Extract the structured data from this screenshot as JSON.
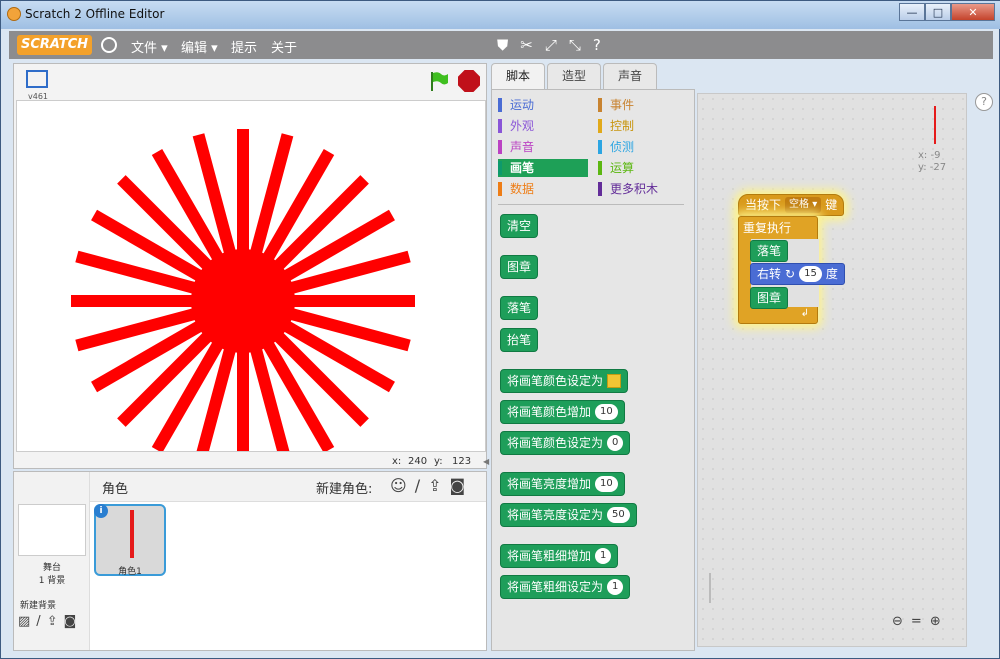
{
  "window": {
    "title": "Scratch 2 Offline Editor",
    "minimize": "—",
    "maximize": "□",
    "close": "✕"
  },
  "menubar": {
    "logo": "SCRATCH",
    "file": "文件 ▾",
    "edit": "编辑 ▾",
    "tips": "提示",
    "about": "关于"
  },
  "stage": {
    "version": "v461",
    "mouse_x_label": "x:",
    "mouse_x": "240",
    "mouse_y_label": "y:",
    "mouse_y": "123",
    "drawing": {
      "lines": 24,
      "color": "#ff0000"
    }
  },
  "sprites": {
    "header": "角色",
    "new_sprite_label": "新建角色:",
    "stage_label": "舞台",
    "stage_backdrops": "1 背景",
    "new_backdrop": "新建背景",
    "sprite1_name": "角色1"
  },
  "tabs": [
    "脚本",
    "造型",
    "声音"
  ],
  "categories": [
    {
      "label": "运动",
      "color": "#4a6cd4"
    },
    {
      "label": "事件",
      "color": "#c88330"
    },
    {
      "label": "外观",
      "color": "#8a55d7"
    },
    {
      "label": "控制",
      "color": "#e1a91a"
    },
    {
      "label": "声音",
      "color": "#bb42c3"
    },
    {
      "label": "侦测",
      "color": "#2ca5e2"
    },
    {
      "label": "画笔",
      "color": "#0e9a6c"
    },
    {
      "label": "运算",
      "color": "#5cb712"
    },
    {
      "label": "数据",
      "color": "#ee7d16"
    },
    {
      "label": "更多积木",
      "color": "#632d99"
    }
  ],
  "blocks": {
    "clear": "清空",
    "stamp": "图章",
    "pen_down": "落笔",
    "pen_up": "抬笔",
    "set_color_to": "将画笔颜色设定为",
    "change_color_by": "将画笔颜色增加",
    "change_color_by_value": "10",
    "set_color_to_num": "将画笔颜色设定为",
    "set_color_to_num_value": "0",
    "change_shade_by": "将画笔亮度增加",
    "change_shade_by_value": "10",
    "set_shade_to": "将画笔亮度设定为",
    "set_shade_to_value": "50",
    "change_size_by": "将画笔粗细增加",
    "change_size_by_value": "1",
    "set_size_to": "将画笔粗细设定为",
    "set_size_to_value": "1"
  },
  "script": {
    "hat_prefix": "当按下",
    "hat_key": "空格 ▾",
    "hat_suffix": "键",
    "forever": "重复执行",
    "pen_down": "落笔",
    "turn_prefix": "右转",
    "turn_value": "15",
    "turn_suffix": "度",
    "stamp": "图章",
    "sprite_x": "x: -9",
    "sprite_y": "y: -27"
  },
  "colors": {
    "pen_green": "#1e9e5a",
    "event_orange": "#d99a1c",
    "control_gold": "#e0a325",
    "motion_blue": "#4a6cd4"
  }
}
